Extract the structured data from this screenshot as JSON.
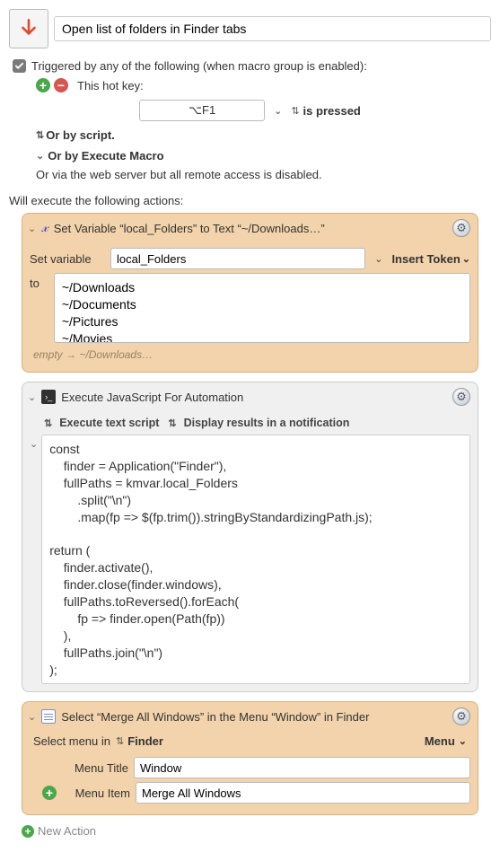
{
  "title": "Open list of folders in Finder tabs",
  "trigger": {
    "header": "Triggered by any of the following (when macro group is enabled):",
    "hotkey_label": "This hot key:",
    "hotkey_value": "⌥F1",
    "pressed_label": "is pressed",
    "or_script": "Or by script.",
    "or_execute": "Or by Execute Macro",
    "or_web": "Or via the web server but all remote access is disabled."
  },
  "actions_header": "Will execute the following actions:",
  "setvar": {
    "title": "Set Variable “local_Folders” to Text “~/Downloads…”",
    "setvar_lbl": "Set variable",
    "var_name": "local_Folders",
    "insert_token": "Insert Token",
    "to_lbl": "to",
    "text": "~/Downloads\n~/Documents\n~/Pictures\n~/Movies",
    "hint": "empty → ~/Downloads…"
  },
  "jxa": {
    "title": "Execute JavaScript For Automation",
    "sub1": "Execute text script",
    "sub2": "Display results in a notification",
    "code": "const\n    finder = Application(\"Finder\"),\n    fullPaths = kmvar.local_Folders\n        .split(\"\\n\")\n        .map(fp => $(fp.trim()).stringByStandardizingPath.js);\n\nreturn (\n    finder.activate(),\n    finder.close(finder.windows),\n    fullPaths.toReversed().forEach(\n        fp => finder.open(Path(fp))\n    ),\n    fullPaths.join(\"\\n\")\n);"
  },
  "selmenu": {
    "title": "Select “Merge All Windows” in the Menu “Window” in Finder",
    "select_in": "Select menu in",
    "app": "Finder",
    "menu_btn": "Menu",
    "menu_title_lbl": "Menu Title",
    "menu_title_val": "Window",
    "menu_item_lbl": "Menu Item",
    "menu_item_val": "Merge All Windows"
  },
  "new_action": "New Action",
  "chart_data": null
}
